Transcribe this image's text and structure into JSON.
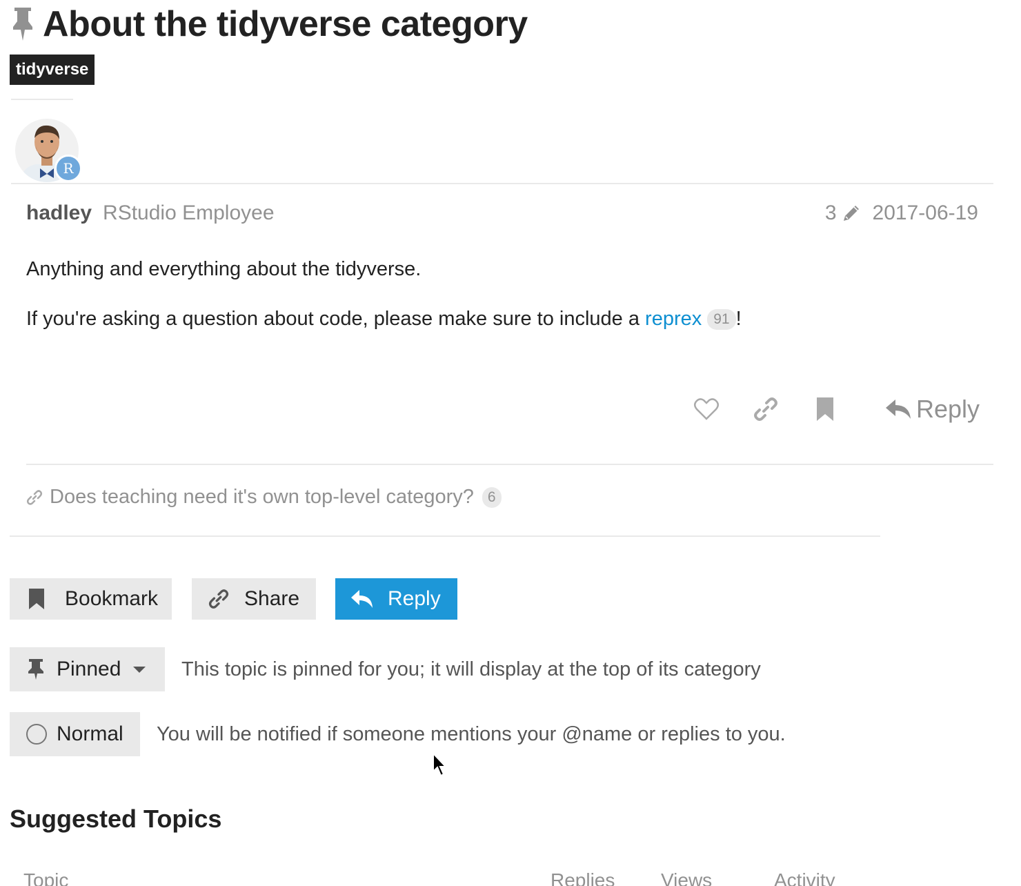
{
  "topic": {
    "title": "About the tidyverse category",
    "category": "tidyverse"
  },
  "post": {
    "username": "hadley",
    "user_title": "RStudio Employee",
    "avatar_flair": "R",
    "edit_count": "3",
    "date": "2017-06-19",
    "line1": "Anything and everything about the tidyverse.",
    "line2_prefix": "If you're asking a question about code, please make sure to include a ",
    "line2_link": "reprex",
    "line2_link_clicks": "91",
    "line2_suffix": "!",
    "reply_label": "Reply"
  },
  "linked_topics": [
    {
      "title": "Does teaching need it's own top-level category?",
      "clicks": "6"
    }
  ],
  "footer_buttons": {
    "bookmark": "Bookmark",
    "share": "Share",
    "reply": "Reply"
  },
  "notifications": {
    "pinned_label": "Pinned",
    "pinned_desc": "This topic is pinned for you; it will display at the top of its category",
    "level_label": "Normal",
    "level_desc": "You will be notified if someone mentions your @name or replies to you."
  },
  "suggested": {
    "title": "Suggested Topics",
    "columns": [
      "Topic",
      "Replies",
      "Views",
      "Activity"
    ]
  },
  "colors": {
    "accent": "#1d97d8",
    "link": "#0e8fd1",
    "muted": "#919191",
    "category_badge": "#222222"
  }
}
